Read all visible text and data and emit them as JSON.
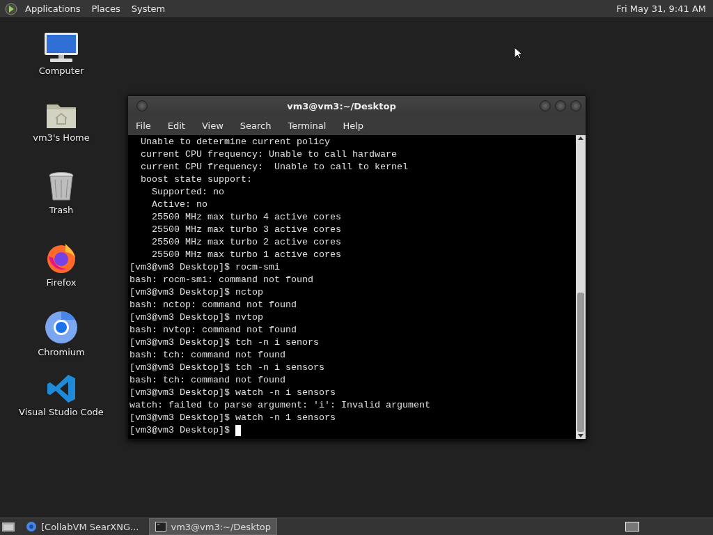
{
  "top_panel": {
    "menus": [
      "Applications",
      "Places",
      "System"
    ],
    "clock": "Fri May 31, 9:41 AM"
  },
  "desktop_icons": [
    {
      "kind": "computer",
      "label": "Computer"
    },
    {
      "kind": "home",
      "label": "vm3's Home"
    },
    {
      "kind": "trash",
      "label": "Trash"
    },
    {
      "kind": "firefox",
      "label": "Firefox"
    },
    {
      "kind": "chromium",
      "label": "Chromium"
    },
    {
      "kind": "vscode",
      "label": "Visual Studio Code"
    }
  ],
  "terminal_window": {
    "title": "vm3@vm3:~/Desktop",
    "menu": [
      "File",
      "Edit",
      "View",
      "Search",
      "Terminal",
      "Help"
    ],
    "lines": [
      "  Unable to determine current policy",
      "  current CPU frequency: Unable to call hardware",
      "  current CPU frequency:  Unable to call to kernel",
      "  boost state support:",
      "    Supported: no",
      "    Active: no",
      "    25500 MHz max turbo 4 active cores",
      "    25500 MHz max turbo 3 active cores",
      "    25500 MHz max turbo 2 active cores",
      "    25500 MHz max turbo 1 active cores",
      "[vm3@vm3 Desktop]$ rocm-smi",
      "bash: rocm-smi: command not found",
      "[vm3@vm3 Desktop]$ nctop",
      "bash: nctop: command not found",
      "[vm3@vm3 Desktop]$ nvtop",
      "bash: nvtop: command not found",
      "[vm3@vm3 Desktop]$ tch -n i senors",
      "bash: tch: command not found",
      "[vm3@vm3 Desktop]$ tch -n i sensors",
      "bash: tch: command not found",
      "[vm3@vm3 Desktop]$ watch -n i sensors",
      "watch: failed to parse argument: 'i': Invalid argument",
      "[vm3@vm3 Desktop]$ watch -n 1 sensors",
      "[vm3@vm3 Desktop]$ "
    ]
  },
  "taskbar": {
    "tasks": [
      {
        "kind": "browser",
        "label": "[CollabVM SearXNG...",
        "selected": false
      },
      {
        "kind": "terminal",
        "label": "vm3@vm3:~/Desktop",
        "selected": true
      }
    ]
  }
}
